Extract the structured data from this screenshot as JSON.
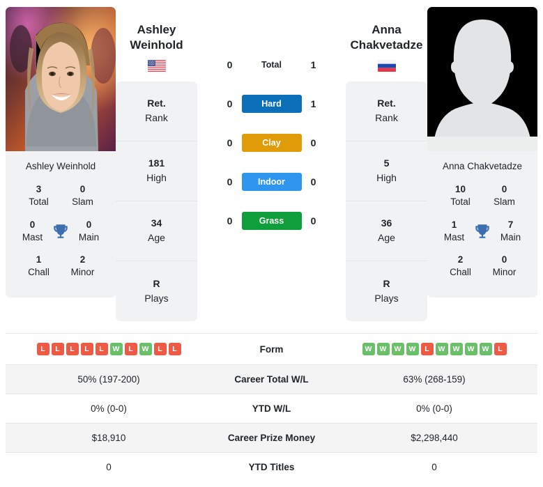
{
  "players": {
    "left": {
      "first_name": "Ashley",
      "last_name": "Weinhold",
      "full_name": "Ashley Weinhold",
      "country": "United States",
      "flag_icon": "flag-us-icon",
      "photo_alt": "Ashley Weinhold photo",
      "titles": {
        "total_value": "3",
        "total_label": "Total",
        "slam_value": "0",
        "slam_label": "Slam",
        "mast_value": "0",
        "mast_label": "Mast",
        "main_value": "0",
        "main_label": "Main",
        "chall_value": "1",
        "chall_label": "Chall",
        "minor_value": "2",
        "minor_label": "Minor"
      },
      "stats": [
        {
          "value": "Ret.",
          "label": "Rank"
        },
        {
          "value": "181",
          "label": "High"
        },
        {
          "value": "34",
          "label": "Age"
        },
        {
          "value": "R",
          "label": "Plays"
        }
      ],
      "form": [
        "L",
        "L",
        "L",
        "L",
        "L",
        "W",
        "L",
        "W",
        "L",
        "L"
      ]
    },
    "right": {
      "first_name": "Anna",
      "last_name": "Chakvetadze",
      "full_name": "Anna Chakvetadze",
      "country": "Russia",
      "flag_icon": "flag-ru-icon",
      "photo_alt": "Anna Chakvetadze photo",
      "titles": {
        "total_value": "10",
        "total_label": "Total",
        "slam_value": "0",
        "slam_label": "Slam",
        "mast_value": "1",
        "mast_label": "Mast",
        "main_value": "7",
        "main_label": "Main",
        "chall_value": "2",
        "chall_label": "Chall",
        "minor_value": "0",
        "minor_label": "Minor"
      },
      "stats": [
        {
          "value": "Ret.",
          "label": "Rank"
        },
        {
          "value": "5",
          "label": "High"
        },
        {
          "value": "36",
          "label": "Age"
        },
        {
          "value": "R",
          "label": "Plays"
        }
      ],
      "form": [
        "W",
        "W",
        "W",
        "W",
        "L",
        "W",
        "W",
        "W",
        "W",
        "L"
      ]
    }
  },
  "head_to_head": [
    {
      "label": "Total",
      "left": "0",
      "right": "1",
      "color": "",
      "styled": false
    },
    {
      "label": "Hard",
      "left": "0",
      "right": "1",
      "color": "#0b6fba",
      "styled": true
    },
    {
      "label": "Clay",
      "left": "0",
      "right": "0",
      "color": "#e09c08",
      "styled": true
    },
    {
      "label": "Indoor",
      "left": "0",
      "right": "0",
      "color": "#2f96f0",
      "styled": true
    },
    {
      "label": "Grass",
      "left": "0",
      "right": "0",
      "color": "#109e3c",
      "styled": true
    }
  ],
  "comparison_rows": [
    {
      "label": "Form",
      "left": "",
      "right": "",
      "type": "form",
      "shaded": false
    },
    {
      "label": "Career Total W/L",
      "left": "50% (197-200)",
      "right": "63% (268-159)",
      "type": "text",
      "shaded": true
    },
    {
      "label": "YTD W/L",
      "left": "0% (0-0)",
      "right": "0% (0-0)",
      "type": "text",
      "shaded": false
    },
    {
      "label": "Career Prize Money",
      "left": "$18,910",
      "right": "$2,298,440",
      "type": "text",
      "shaded": true
    },
    {
      "label": "YTD Titles",
      "left": "0",
      "right": "0",
      "type": "text",
      "shaded": false
    }
  ],
  "colors": {
    "hard": "#0b6fba",
    "clay": "#e09c08",
    "indoor": "#2f96f0",
    "grass": "#109e3c",
    "win_badge": "#6abf69",
    "loss_badge": "#ef5a45",
    "trophy": "#3d6fb0",
    "card_bg": "#f1f2f3"
  },
  "icons": {
    "trophy": "trophy-icon"
  }
}
